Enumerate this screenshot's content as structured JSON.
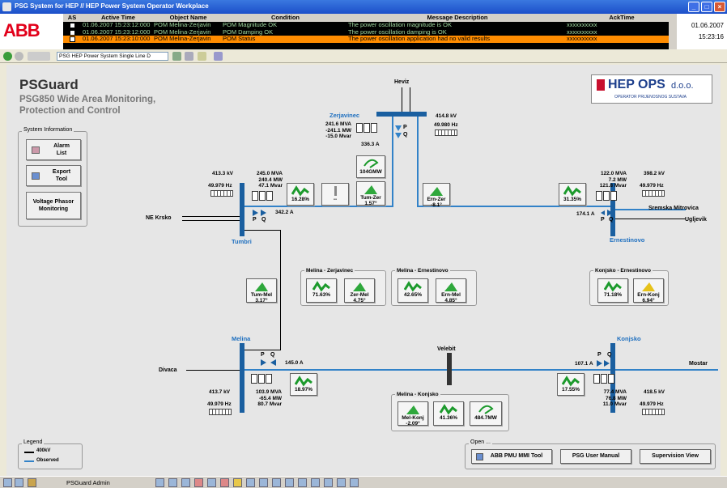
{
  "window": {
    "title": "PSG System for HEP // HEP Power System Operator Workplace"
  },
  "brand": {
    "logo": "ABB"
  },
  "alarms": {
    "columns": [
      "AS",
      "Active Time",
      "Object Name",
      "Condition",
      "Message Description",
      "AckTime"
    ],
    "rows": [
      {
        "time": "01.06.2007 15:23:12:000",
        "object": "POM Melina-Zerjavin",
        "condition": "POM Magnitude OK",
        "message": "The power oscillation magnitude is OK",
        "ack": "xxxxxxxxxx"
      },
      {
        "time": "01.06.2007 15:23:12:000",
        "object": "POM Melina-Zerjavin",
        "condition": "POM Damping OK",
        "message": "The power oscillation damping is OK",
        "ack": "xxxxxxxxxx"
      },
      {
        "time": "01.06.2007 15:23:10:000",
        "object": "POM Melina-Zerjavin",
        "condition": "POM Status",
        "message": "The power oscillation application had no valid results",
        "ack": "xxxxxxxxxx"
      }
    ]
  },
  "clock": {
    "date": "01.06.2007",
    "time": "15:23:16"
  },
  "toolbar": {
    "view_select": "PSG HEP Power System Single Line D"
  },
  "app": {
    "title": "PSGuard",
    "subtitle1": "PSG850 Wide Area Monitoring,",
    "subtitle2": "Protection and Control"
  },
  "hep": {
    "name": "HEP OPS",
    "suffix": "d.o.o.",
    "tagline": "OPERATOR PRIJENOSNOG SUSTAVA"
  },
  "sysinfo": {
    "title": "System Information",
    "alarm": "Alarm List",
    "export": "Export Tool",
    "voltage": "Voltage Phasor Monitoring"
  },
  "stations": {
    "heviz": "Heviz",
    "zerjavinec": "Zerjavinec",
    "tumbri": "Tumbri",
    "ernestinovo": "Ernestinovo",
    "melina": "Melina",
    "konjsko": "Konjsko",
    "velebit": "Velebit",
    "ne_krsko": "NE Krsko",
    "divaca": "Divaca",
    "sremska": "Sremska Mitrovica",
    "ugljevik": "Ugljevik",
    "mostar": "Mostar"
  },
  "meas": {
    "zer_s": "241.6 MVA",
    "zer_p": "-241.1 MW",
    "zer_q": "-15.0 Mvar",
    "zer_i": "336.3 A",
    "zer_kv": "414.8 kV",
    "zer_hz": "49.980 Hz",
    "tum_kv": "413.3 kV",
    "tum_hz": "49.979 Hz",
    "tum_s": "245.0 MVA",
    "tum_p": "240.4 MW",
    "tum_q": "47.1 Mvar",
    "tum_i": "342.2 A",
    "ern_s": "122.0 MVA",
    "ern_p": "7.2 MW",
    "ern_q": "121.8 Mvar",
    "ern_kv": "398.2 kV",
    "ern_hz": "49.979 Hz",
    "ern_i": "174.1 A",
    "mel_kv": "413.7 kV",
    "mel_hz": "49.979 Hz",
    "mel_s": "103.9 MVA",
    "mel_p": "-65.4 MW",
    "mel_q": "80.7 Mvar",
    "mel_i": "145.0 A",
    "kon_i": "107.1 A",
    "kon_s": "77.4 MVA",
    "kon_p": "76.8 MW",
    "kon_q": "11.0 Mvar",
    "kon_kv": "418.5 kV",
    "kon_hz": "49.979 Hz",
    "p": "P",
    "q": "Q"
  },
  "widgets": {
    "w1": {
      "value": "16.28%"
    },
    "w2": {
      "value": "--"
    },
    "w3": {
      "label": "Tum-Zer",
      "value": "1.57°"
    },
    "w4": {
      "value": "104GMW"
    },
    "w5": {
      "label": "Ern-Zer",
      "value": "-8.1°"
    },
    "w6": {
      "value": "31.35%"
    },
    "w7": {
      "label": "Tum-Mel",
      "value": "3.17°"
    },
    "w8": {
      "value": "71.63%"
    },
    "w9": {
      "label": "Zer-Mel",
      "value": "4.75°"
    },
    "w10": {
      "value": "42.65%"
    },
    "w11": {
      "label": "Ern-Mel",
      "value": "4.85°"
    },
    "w12": {
      "value": "71.18%"
    },
    "w13": {
      "label": "Ern-Konj",
      "value": "6.94°"
    },
    "w14": {
      "value": "18.97%"
    },
    "w15": {
      "value": "17.55%"
    },
    "w16": {
      "label": "Mel-Konj",
      "value": "-2.09°"
    },
    "w17": {
      "value": "41.36%"
    },
    "w18": {
      "value": "484.7MW"
    }
  },
  "panels": {
    "melina_zer": "Melina - Zerjavinec",
    "melina_ern": "Melina - Ernestinovo",
    "konjsko_ern": "Konjsko - Ernestinovo",
    "melina_konj": "Melina - Konjsko",
    "open": "Open ...",
    "legend": "Legend"
  },
  "legend": {
    "item1": "400kV",
    "item2": "Observed"
  },
  "open_buttons": {
    "pmu": "ABB PMU MMI Tool",
    "manual": "PSG User Manual",
    "supervision": "Supervision View"
  },
  "taskbar": {
    "user": "PSGuard Admin"
  },
  "colors": {
    "observed": "#3282c8",
    "bus": "#1a5fa0",
    "station_label": "#1e6fbf"
  }
}
